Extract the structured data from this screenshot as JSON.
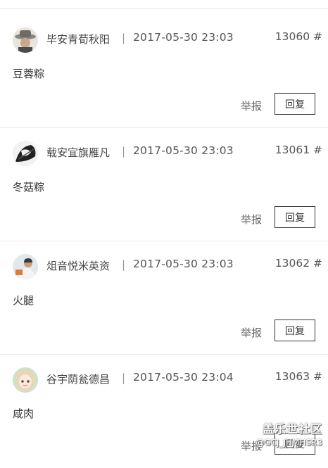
{
  "posts": [
    {
      "author": "毕安青荀秋阳",
      "separator": "|",
      "time": "2017-05-30 23:03",
      "floor": "13060 #",
      "content": "豆蓉粽",
      "report_label": "举报",
      "reply_label": "回复",
      "avatar_icon": "avatar-hat-icon"
    },
    {
      "author": "载安宜旗雁凡",
      "separator": "|",
      "time": "2017-05-30 23:03",
      "floor": "13061 #",
      "content": "冬菇粽",
      "report_label": "举报",
      "reply_label": "回复",
      "avatar_icon": "avatar-sketch-icon"
    },
    {
      "author": "俎音悦米英资",
      "separator": "|",
      "time": "2017-05-30 23:03",
      "floor": "13062 #",
      "content": "火腿",
      "report_label": "举报",
      "reply_label": "回复",
      "avatar_icon": "avatar-person-icon"
    },
    {
      "author": "谷宇荫瓮德昌",
      "separator": "|",
      "time": "2017-05-30 23:04",
      "floor": "13063 #",
      "content": "咸肉",
      "report_label": "举报",
      "reply_label": "回复",
      "avatar_icon": "avatar-anime-girl-icon"
    }
  ],
  "watermark": {
    "logo": "盖乐世社区",
    "handle": "@GCJ_JHMHSR3"
  },
  "colors": {
    "text": "#333333",
    "muted": "#555555",
    "divider": "#e8e8e8",
    "button_border": "#333333"
  }
}
